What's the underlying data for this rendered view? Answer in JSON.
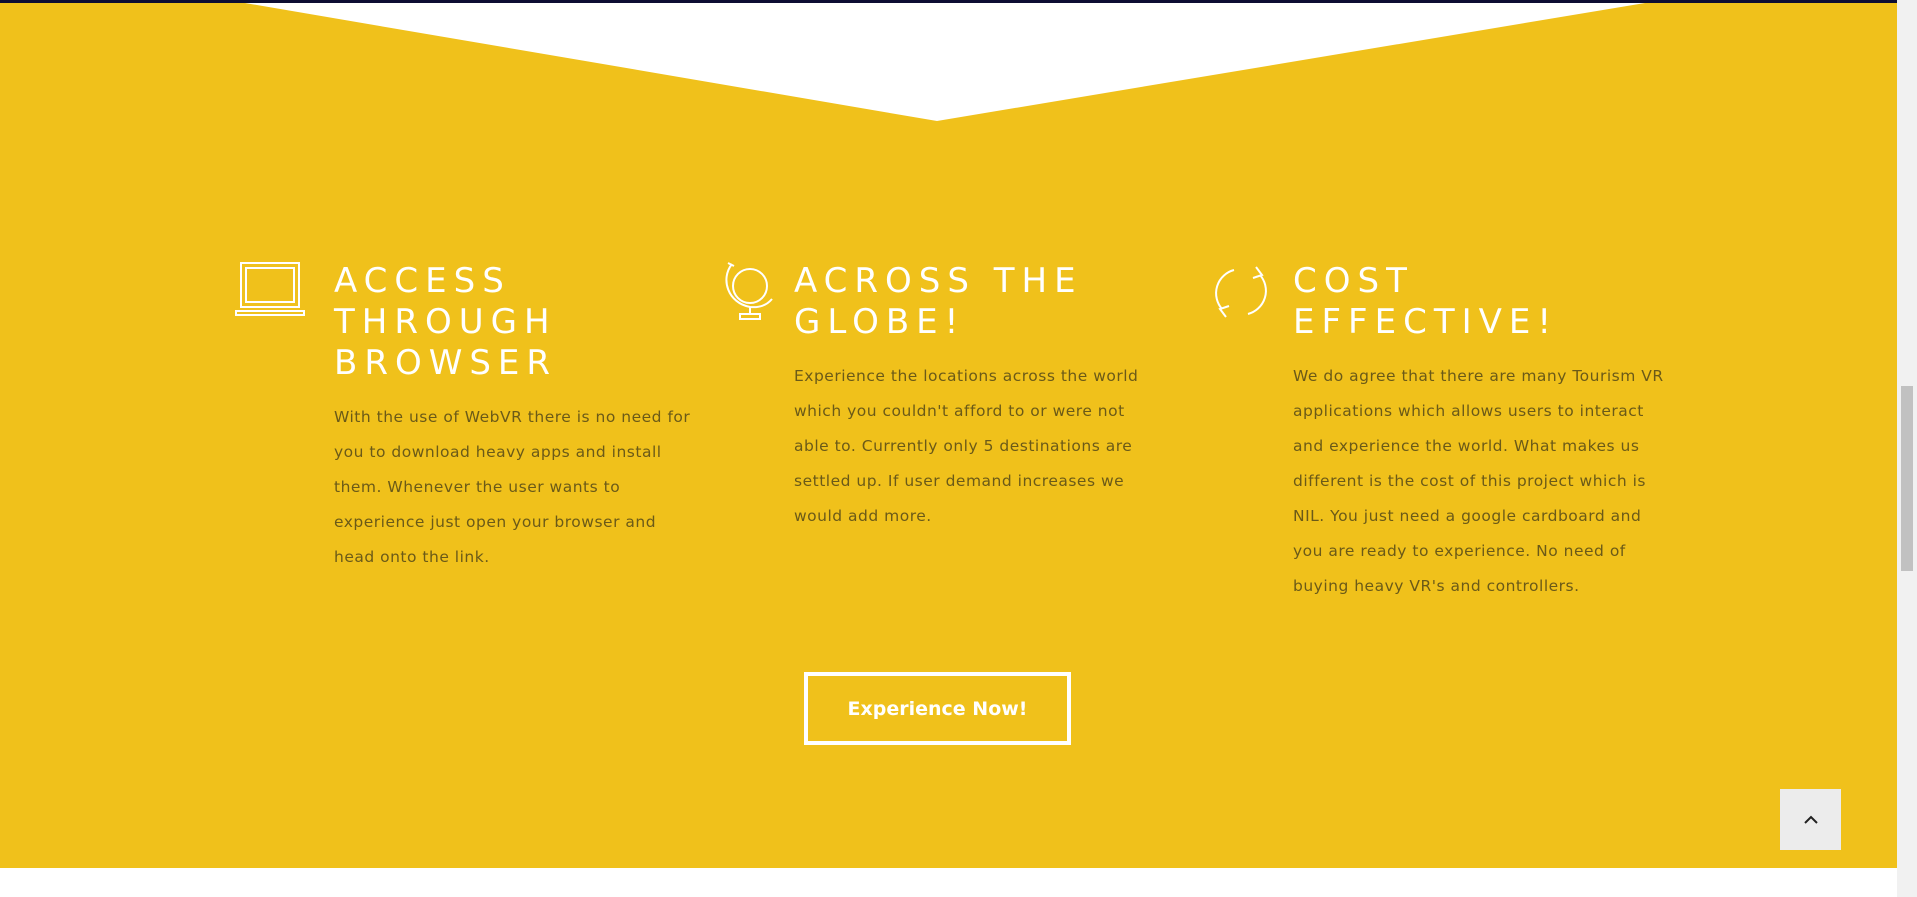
{
  "features": [
    {
      "icon": "laptop-icon",
      "title": "ACCESS THROUGH BROWSER",
      "description": "With the use of WebVR there is no need for you to download heavy apps and install them. Whenever the user wants to experience just open your browser and head onto the link."
    },
    {
      "icon": "globe-icon",
      "title": "ACROSS THE GLOBE!",
      "description": "Experience the locations across the world which you couldn't afford to or were not able to. Currently only 5 destinations are settled up. If user demand increases we would add more."
    },
    {
      "icon": "refresh-icon",
      "title": "COST EFFECTIVE!",
      "description": "We do agree that there are many Tourism VR applications which allows users to interact and experience the world. What makes us different is the cost of this project which is NIL. You just need a google cardboard and you are ready to experience. No need of buying heavy VR's and controllers."
    }
  ],
  "cta": {
    "label": "Experience Now!"
  },
  "back_to_top": {
    "icon": "chevron-up-icon"
  },
  "colors": {
    "section_bg": "#f0c11b",
    "heading": "#ffffff",
    "body_text": "#6b5a18",
    "top_line": "#0d0d33"
  }
}
